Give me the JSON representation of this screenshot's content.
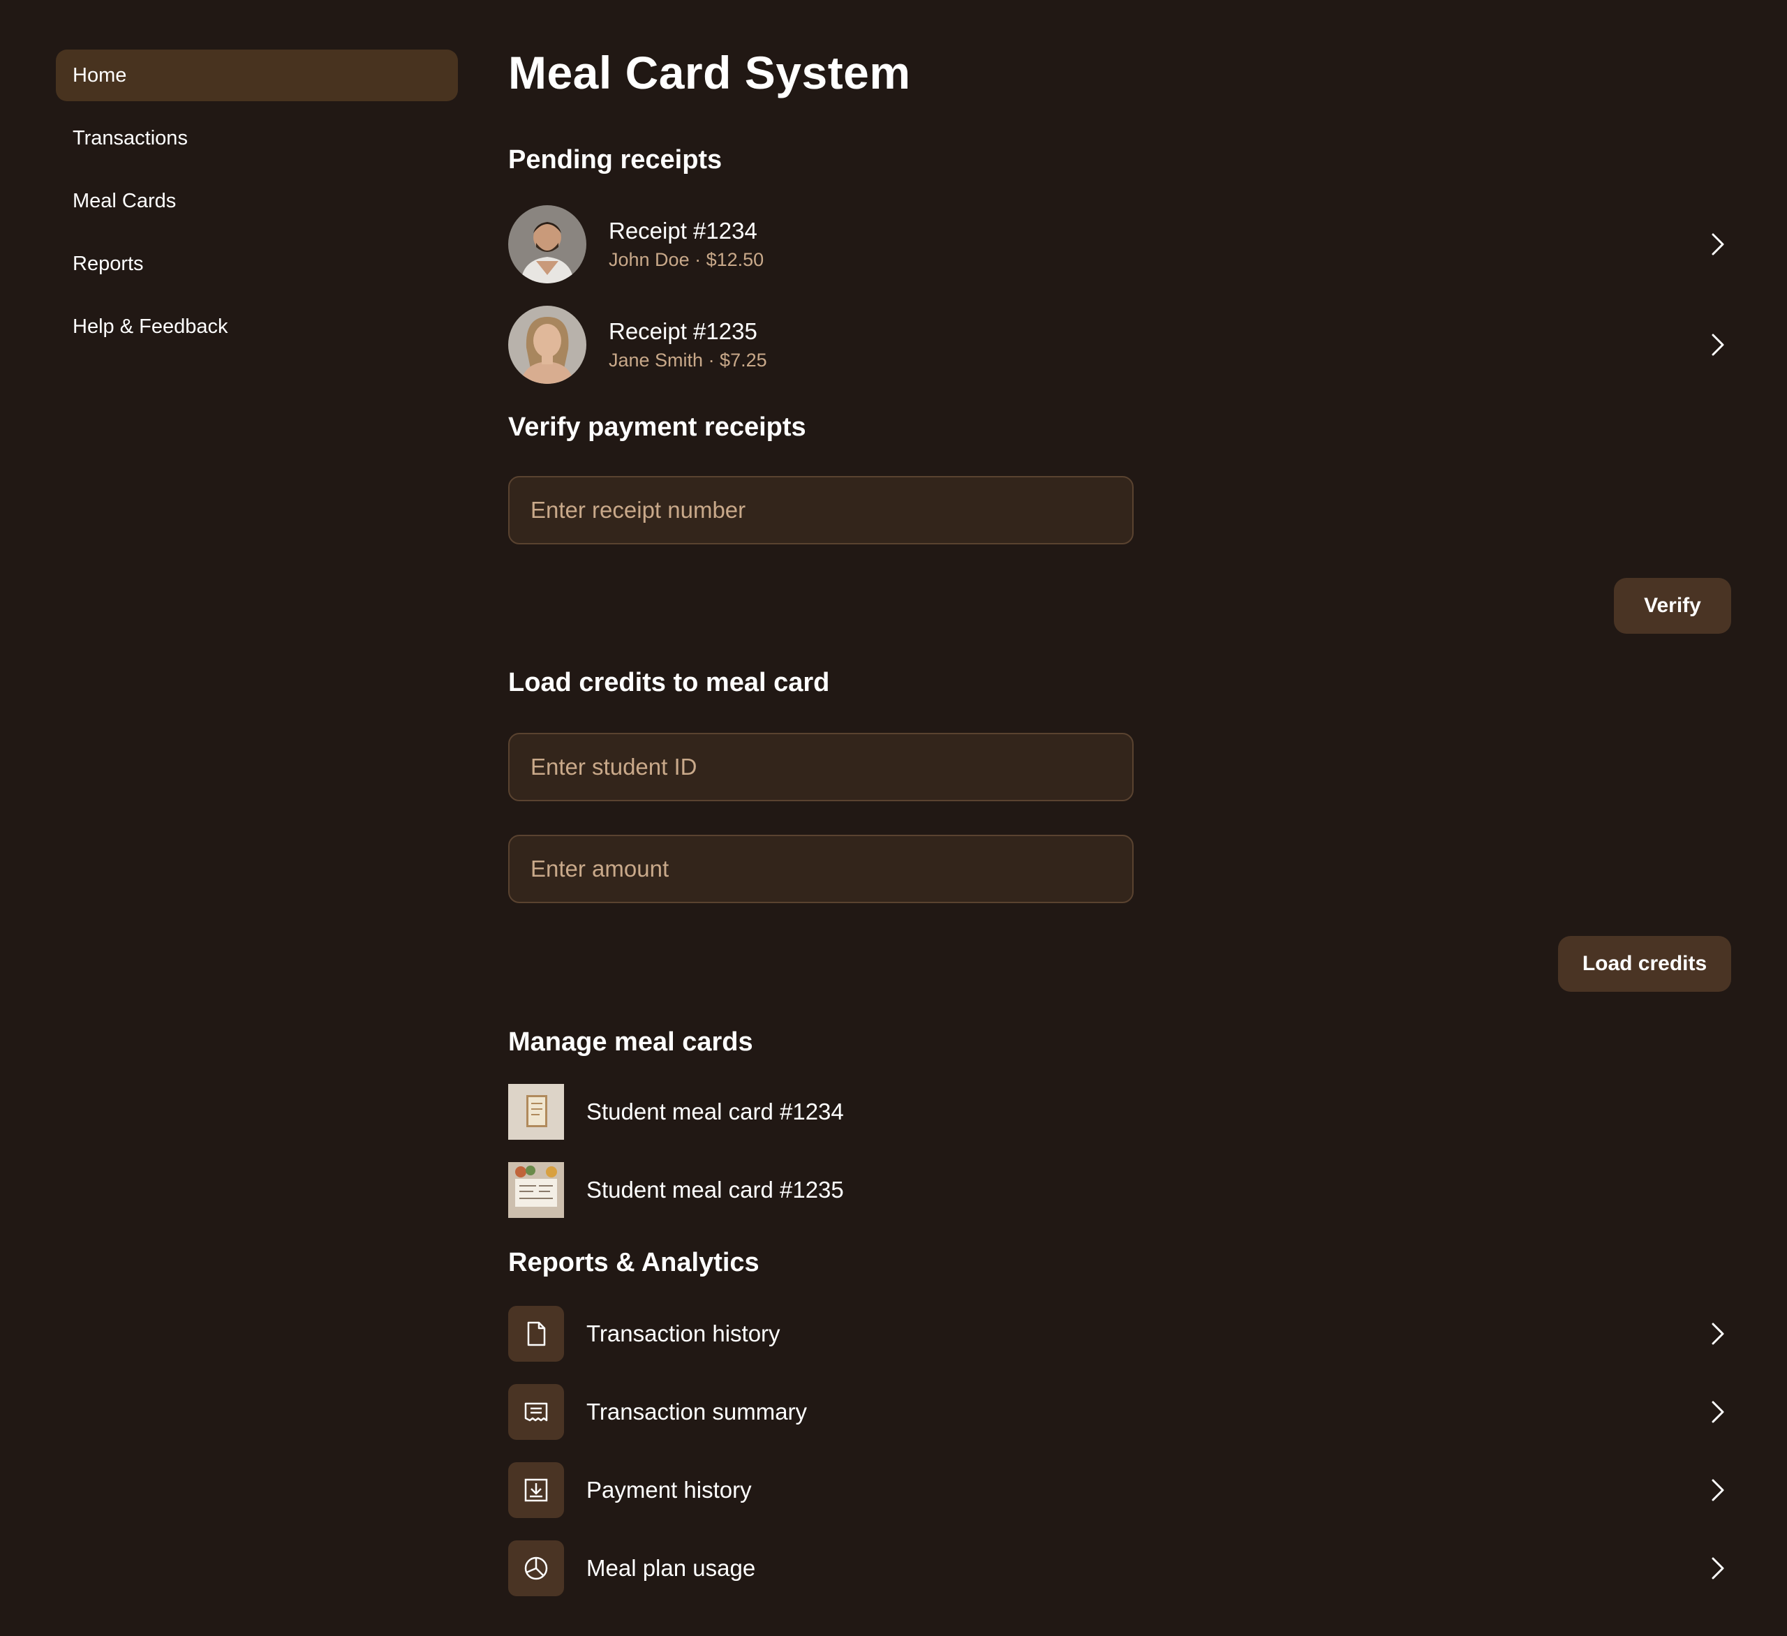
{
  "sidebar": {
    "items": [
      {
        "label": "Home",
        "active": true
      },
      {
        "label": "Transactions"
      },
      {
        "label": "Meal Cards"
      },
      {
        "label": "Reports"
      },
      {
        "label": "Help & Feedback"
      }
    ]
  },
  "main": {
    "title": "Meal Card System",
    "pending": {
      "heading": "Pending receipts",
      "items": [
        {
          "title": "Receipt #1234",
          "subtitle": "John Doe · $12.50",
          "avatar": "man-portrait-avatar"
        },
        {
          "title": "Receipt #1235",
          "subtitle": "Jane Smith · $7.25",
          "avatar": "woman-portrait-avatar"
        }
      ]
    },
    "verify": {
      "heading": "Verify payment receipts",
      "placeholder": "Enter receipt number",
      "value": "",
      "button": "Verify"
    },
    "load": {
      "heading": "Load credits to meal card",
      "student_placeholder": "Enter student ID",
      "amount_placeholder": "Enter amount",
      "button": "Load credits"
    },
    "manage": {
      "heading": "Manage meal cards",
      "items": [
        {
          "label": "Student meal card #1234",
          "icon": "meal-card-thumbnail"
        },
        {
          "label": "Student meal card #1235",
          "icon": "meal-card-thumbnail"
        }
      ]
    },
    "reports": {
      "heading": "Reports & Analytics",
      "items": [
        {
          "label": "Transaction history",
          "icon": "document-icon"
        },
        {
          "label": "Transaction summary",
          "icon": "receipt-icon"
        },
        {
          "label": "Payment history",
          "icon": "download-icon"
        },
        {
          "label": "Meal plan usage",
          "icon": "pie-chart-icon"
        }
      ]
    }
  },
  "colors": {
    "background": "#211814",
    "active_nav": "#48331f",
    "input_bg": "#33251b",
    "button_bg": "#4a3424",
    "muted_text": "#c9a98a"
  }
}
